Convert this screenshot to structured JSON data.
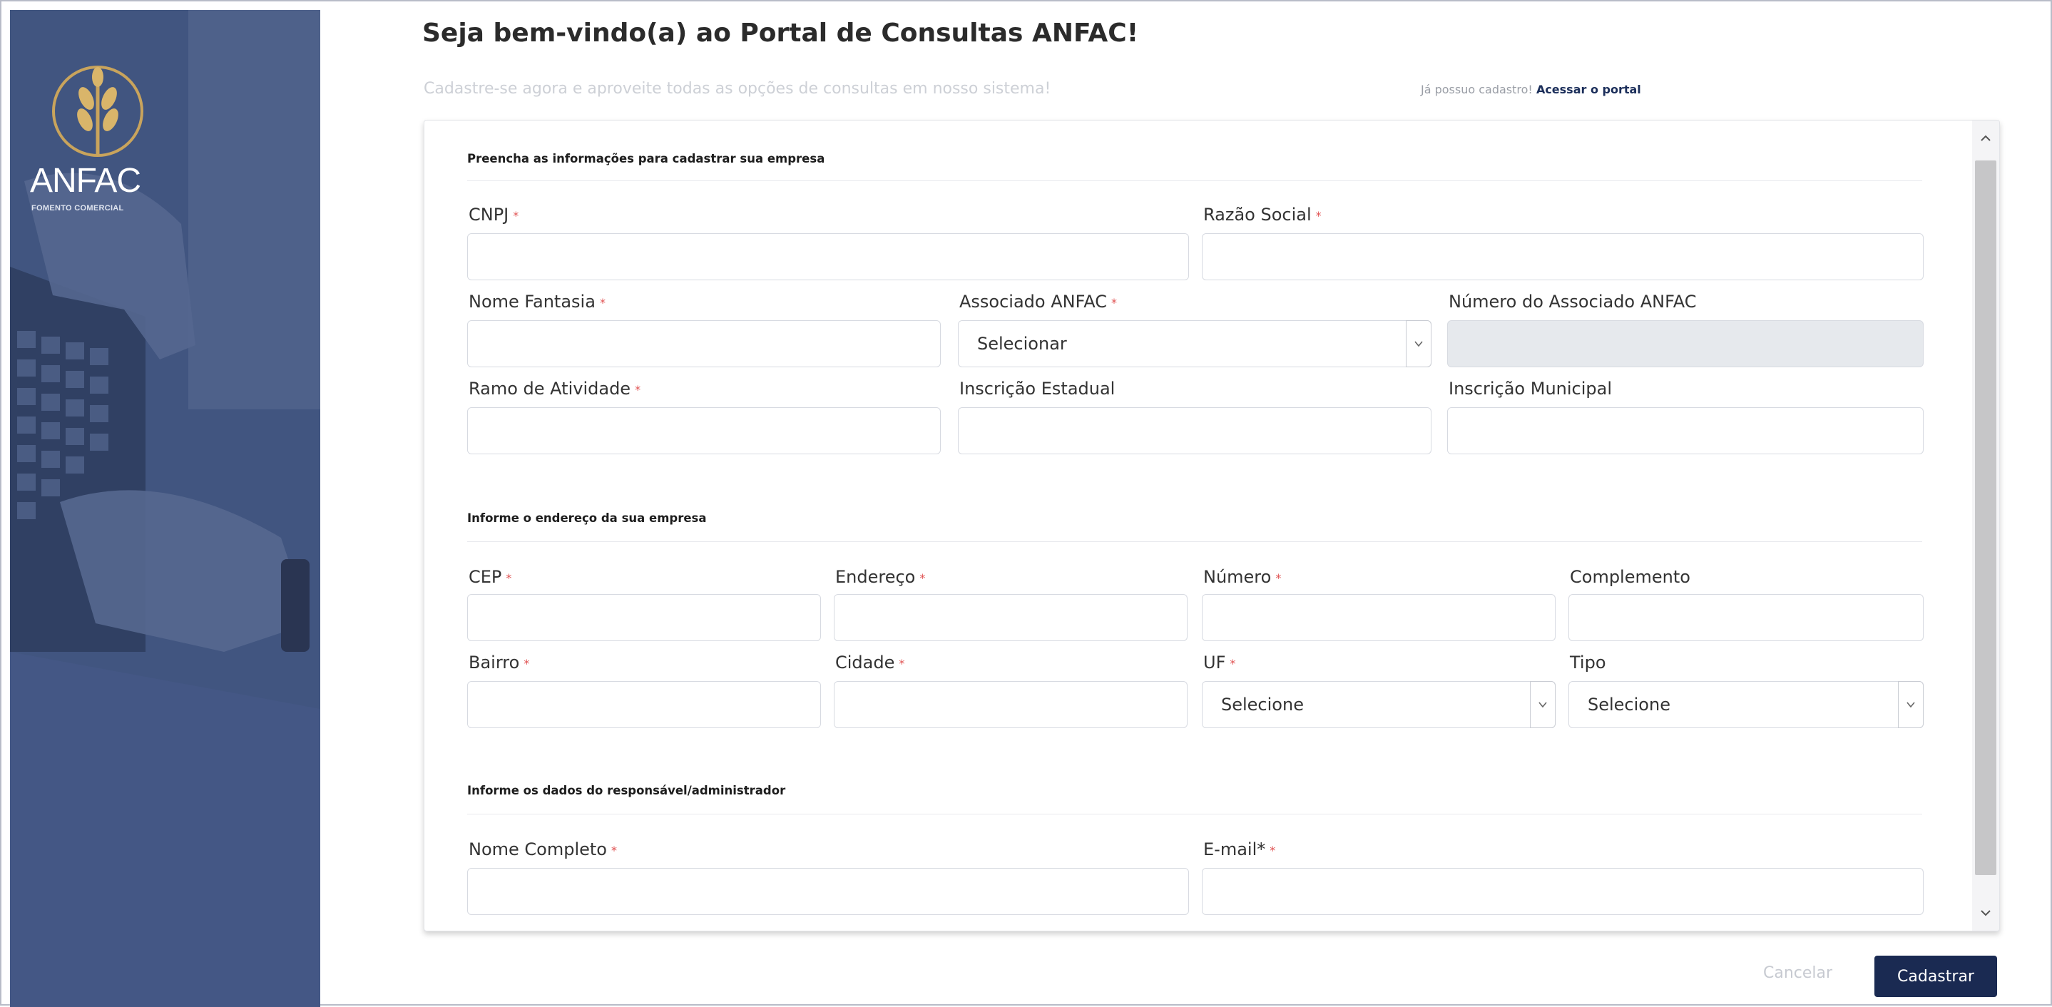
{
  "brand": {
    "name": "ANFAC",
    "subtitle": "FOMENTO COMERCIAL"
  },
  "header": {
    "title_prefix": "Seja bem-vindo(a) ao Portal de Consultas ",
    "title_brand": "ANFAC!",
    "subtitle": "Cadastre-se agora e aproveite todas as opções de consultas em nosso sistema!",
    "already_text": "Já possuo cadastro! ",
    "portal_link": "Acessar o portal"
  },
  "company_section": {
    "title": "Preencha as informações para cadastrar sua empresa",
    "cnpj_label": "CNPJ",
    "razao_label": "Razão Social",
    "fantasia_label": "Nome Fantasia",
    "associado_label": "Associado ANFAC",
    "associado_value": "Selecionar",
    "numero_associado_label": "Número do Associado ANFAC",
    "ramo_label": "Ramo de Atividade",
    "inscricao_estadual_label": "Inscrição Estadual",
    "inscricao_municipal_label": "Inscrição Municipal"
  },
  "address_section": {
    "title": "Informe o endereço da sua empresa",
    "cep_label": "CEP",
    "endereco_label": "Endereço",
    "numero_label": "Número",
    "complemento_label": "Complemento",
    "bairro_label": "Bairro",
    "cidade_label": "Cidade",
    "uf_label": "UF",
    "uf_value": "Selecione",
    "tipo_label": "Tipo",
    "tipo_value": "Selecione"
  },
  "admin_section": {
    "title": "Informe os dados do responsável/administrador",
    "nome_label": "Nome Completo",
    "email_label": "E-mail*"
  },
  "required_mark": "*",
  "footer": {
    "cancel_label": "Cancelar",
    "submit_label": "Cadastrar"
  },
  "colors": {
    "side_panel": "#42567f",
    "primary_button": "#1a2a52",
    "required": "#e05050",
    "logo_gold": "#c9a45c"
  }
}
